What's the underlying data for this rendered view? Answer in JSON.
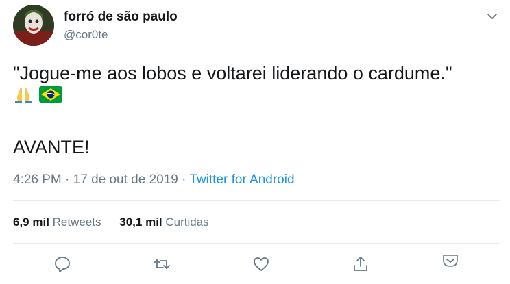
{
  "user": {
    "display_name": "forró de são paulo",
    "handle": "@cor0te"
  },
  "tweet": {
    "text": "\"Jogue-me aos lobos e voltarei liderando o cardume.\"",
    "emojis": [
      "folded-hands",
      "brazil-flag"
    ],
    "shout": "AVANTE!"
  },
  "meta": {
    "time": "4:26 PM",
    "date": "17 de out de 2019",
    "separator": "·",
    "source": "Twitter for Android"
  },
  "stats": {
    "retweets_count": "6,9 mil",
    "retweets_label": "Retweets",
    "likes_count": "30,1 mil",
    "likes_label": "Curtidas"
  },
  "colors": {
    "link": "#1b95e0",
    "muted": "#657786",
    "divider": "#e6ecf0"
  }
}
